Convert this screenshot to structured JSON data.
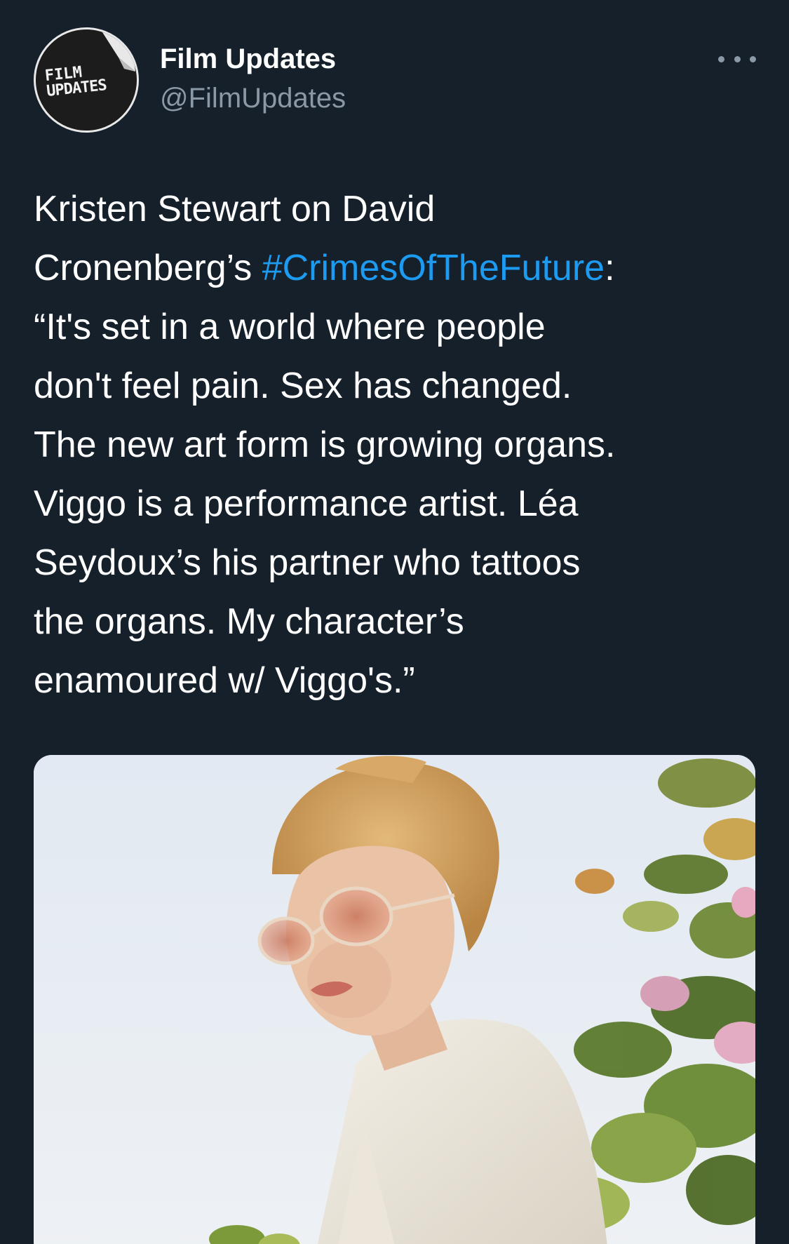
{
  "tweet": {
    "avatar": {
      "icon": "film-updates-logo",
      "logo_line1": "FILM",
      "logo_line2": "UPDATES"
    },
    "author": {
      "display_name": "Film Updates",
      "handle": "@FilmUpdates"
    },
    "more_icon": "ellipsis-icon",
    "text": {
      "part1": "Kristen Stewart on David\nCronenberg’s ",
      "hashtag": "#CrimesOfTheFuture",
      "part2": ":\n“It's set in a world where people\ndon't feel pain. Sex has changed.\nThe new art form is growing organs.\nViggo is a performance artist. Léa\nSeydoux’s his partner who tattoos\nthe organs. My character’s\nenamoured w/ Viggo's.”"
    },
    "media": {
      "type": "photo"
    }
  },
  "colors": {
    "background": "#15202b",
    "text": "#ffffff",
    "secondary_text": "#8b98a5",
    "link": "#1d9bf0"
  }
}
